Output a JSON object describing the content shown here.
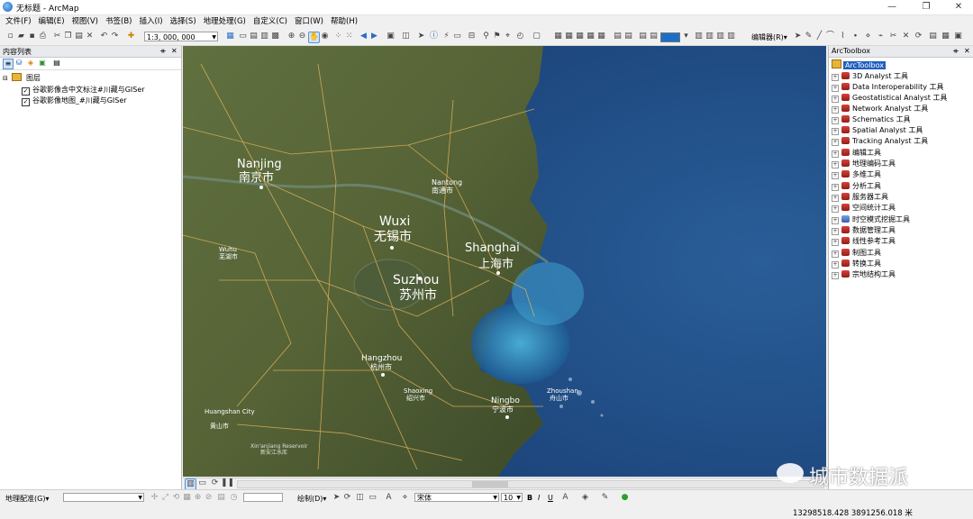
{
  "window": {
    "title": "无标题 - ArcMap",
    "minimize": "—",
    "maximize": "❐",
    "close": "✕"
  },
  "menu": [
    "文件(F)",
    "编辑(E)",
    "视图(V)",
    "书签(B)",
    "插入(I)",
    "选择(S)",
    "地理处理(G)",
    "自定义(C)",
    "窗口(W)",
    "帮助(H)"
  ],
  "toolbar": {
    "scale": "1:3, 000, 000",
    "editor_label": "编辑器(R)▾"
  },
  "toc": {
    "title": "内容列表",
    "root": "图层",
    "layers": [
      {
        "name": "谷歌影像含中文标注#川藏与GISer",
        "checked": true
      },
      {
        "name": "谷歌影像地图_#川藏与GISer",
        "checked": true
      }
    ]
  },
  "map": {
    "cities": [
      {
        "en": "Nanjing",
        "zh": "南京市"
      },
      {
        "en": "Wuxi",
        "zh": "无锡市"
      },
      {
        "en": "Shanghai",
        "zh": "上海市"
      },
      {
        "en": "Suzhou",
        "zh": "苏州市"
      },
      {
        "en": "Wuhu",
        "zh": "芜湖市"
      },
      {
        "en": "Nantong",
        "zh": "南通市"
      },
      {
        "en": "Hangzhou",
        "zh": "杭州市"
      },
      {
        "en": "Shaoxing",
        "zh": "绍兴市"
      },
      {
        "en": "Ningbo",
        "zh": "宁波市"
      },
      {
        "en": "Zhoushan",
        "zh": "舟山市"
      },
      {
        "en": "Huangshan City",
        "zh": "黄山市"
      },
      {
        "en": "Xin'anjiang Reservoir",
        "zh": "新安江水库"
      }
    ],
    "colors": {
      "land": "#5b6842",
      "sea": "#1f4f86",
      "shallow": "#3a9fd0",
      "road": "#e8b45a"
    }
  },
  "toolbox": {
    "title": "ArcToolbox",
    "root": "ArcToolbox",
    "items": [
      "3D Analyst 工具",
      "Data Interoperability 工具",
      "Geostatistical Analyst 工具",
      "Network Analyst 工具",
      "Schematics 工具",
      "Spatial Analyst 工具",
      "Tracking Analyst 工具",
      "编辑工具",
      "地理编码工具",
      "多维工具",
      "分析工具",
      "服务器工具",
      "空间统计工具",
      "时空模式挖掘工具",
      "数据管理工具",
      "线性参考工具",
      "制图工具",
      "转换工具",
      "宗地结构工具"
    ]
  },
  "bottom": {
    "georef": "地理配准(G)▾",
    "draw": "绘制(D)▾",
    "font": "宋体",
    "fontsize": "10",
    "bold": "B",
    "italic": "I",
    "underline": "U",
    "coordinates": "13298518.428  3891256.018 米"
  },
  "watermark": "城市数据派"
}
